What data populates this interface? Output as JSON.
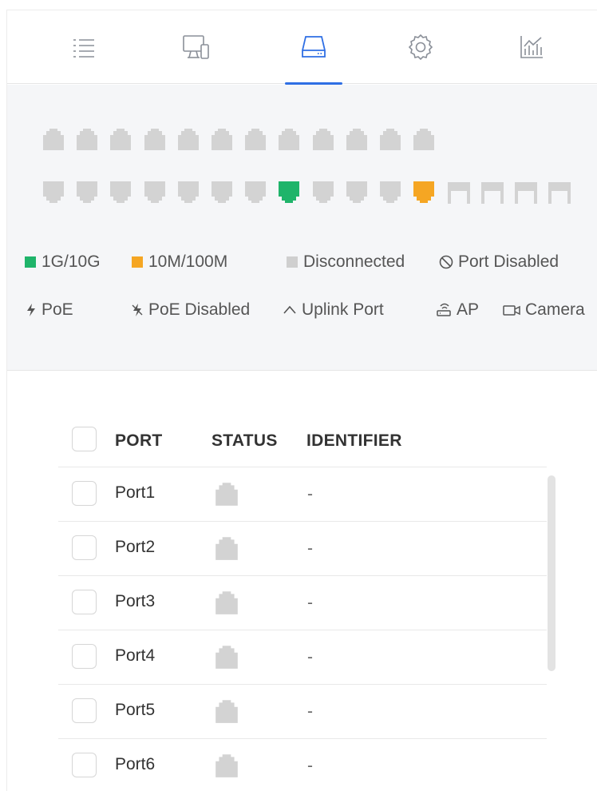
{
  "tabs": [
    {
      "name": "list",
      "icon": "list-icon",
      "active": false
    },
    {
      "name": "devices",
      "icon": "devices-icon",
      "active": false
    },
    {
      "name": "switch",
      "icon": "switch-icon",
      "active": true
    },
    {
      "name": "settings",
      "icon": "gear-icon",
      "active": false
    },
    {
      "name": "statistics",
      "icon": "chart-icon",
      "active": false
    }
  ],
  "colors": {
    "connected_1g_10g": "#1fb46a",
    "connected_10m_100m": "#f5a623",
    "disconnected": "#d3d3d3",
    "accent": "#2f6fe4"
  },
  "port_panel": {
    "top_row": [
      "disconnected",
      "disconnected",
      "disconnected",
      "disconnected",
      "disconnected",
      "disconnected",
      "disconnected",
      "disconnected",
      "disconnected",
      "disconnected",
      "disconnected",
      "disconnected"
    ],
    "bottom_row": [
      "disconnected",
      "disconnected",
      "disconnected",
      "disconnected",
      "disconnected",
      "disconnected",
      "disconnected",
      "1g_10g",
      "disconnected",
      "disconnected",
      "disconnected",
      "10m_100m"
    ],
    "sfp_row": [
      "disconnected",
      "disconnected",
      "disconnected",
      "disconnected"
    ]
  },
  "legend": {
    "speed_1g": "1G/10G",
    "speed_100m": "10M/100M",
    "disconnected": "Disconnected",
    "port_disabled": "Port Disabled",
    "poe": "PoE",
    "poe_disabled": "PoE Disabled",
    "uplink": "Uplink Port",
    "ap": "AP",
    "camera": "Camera"
  },
  "table": {
    "headers": {
      "port": "PORT",
      "status": "STATUS",
      "identifier": "IDENTIFIER"
    },
    "rows": [
      {
        "port": "Port1",
        "status": "disconnected",
        "identifier": "-"
      },
      {
        "port": "Port2",
        "status": "disconnected",
        "identifier": "-"
      },
      {
        "port": "Port3",
        "status": "disconnected",
        "identifier": "-"
      },
      {
        "port": "Port4",
        "status": "disconnected",
        "identifier": "-"
      },
      {
        "port": "Port5",
        "status": "disconnected",
        "identifier": "-"
      },
      {
        "port": "Port6",
        "status": "disconnected",
        "identifier": "-"
      }
    ]
  }
}
